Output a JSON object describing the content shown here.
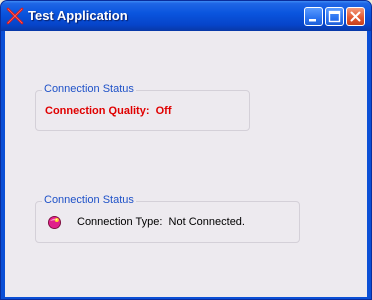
{
  "window": {
    "title": "Test Application"
  },
  "group_quality": {
    "legend": "Connection Status",
    "quality_label": "Connection Quality:",
    "quality_value": "Off"
  },
  "group_type": {
    "legend": "Connection Status",
    "type_label": "Connection Type:",
    "type_value": "Not Connected."
  },
  "icons": {
    "app": "app-x-icon",
    "minimize": "minimize-icon",
    "maximize": "maximize-icon",
    "close": "close-icon",
    "status": "connection-status-icon"
  },
  "colors": {
    "titlebar": "#0a55de",
    "client_bg": "#edeaef",
    "legend_text": "#1f52c8",
    "quality_text": "#e00000",
    "close_button": "#e35a33"
  }
}
